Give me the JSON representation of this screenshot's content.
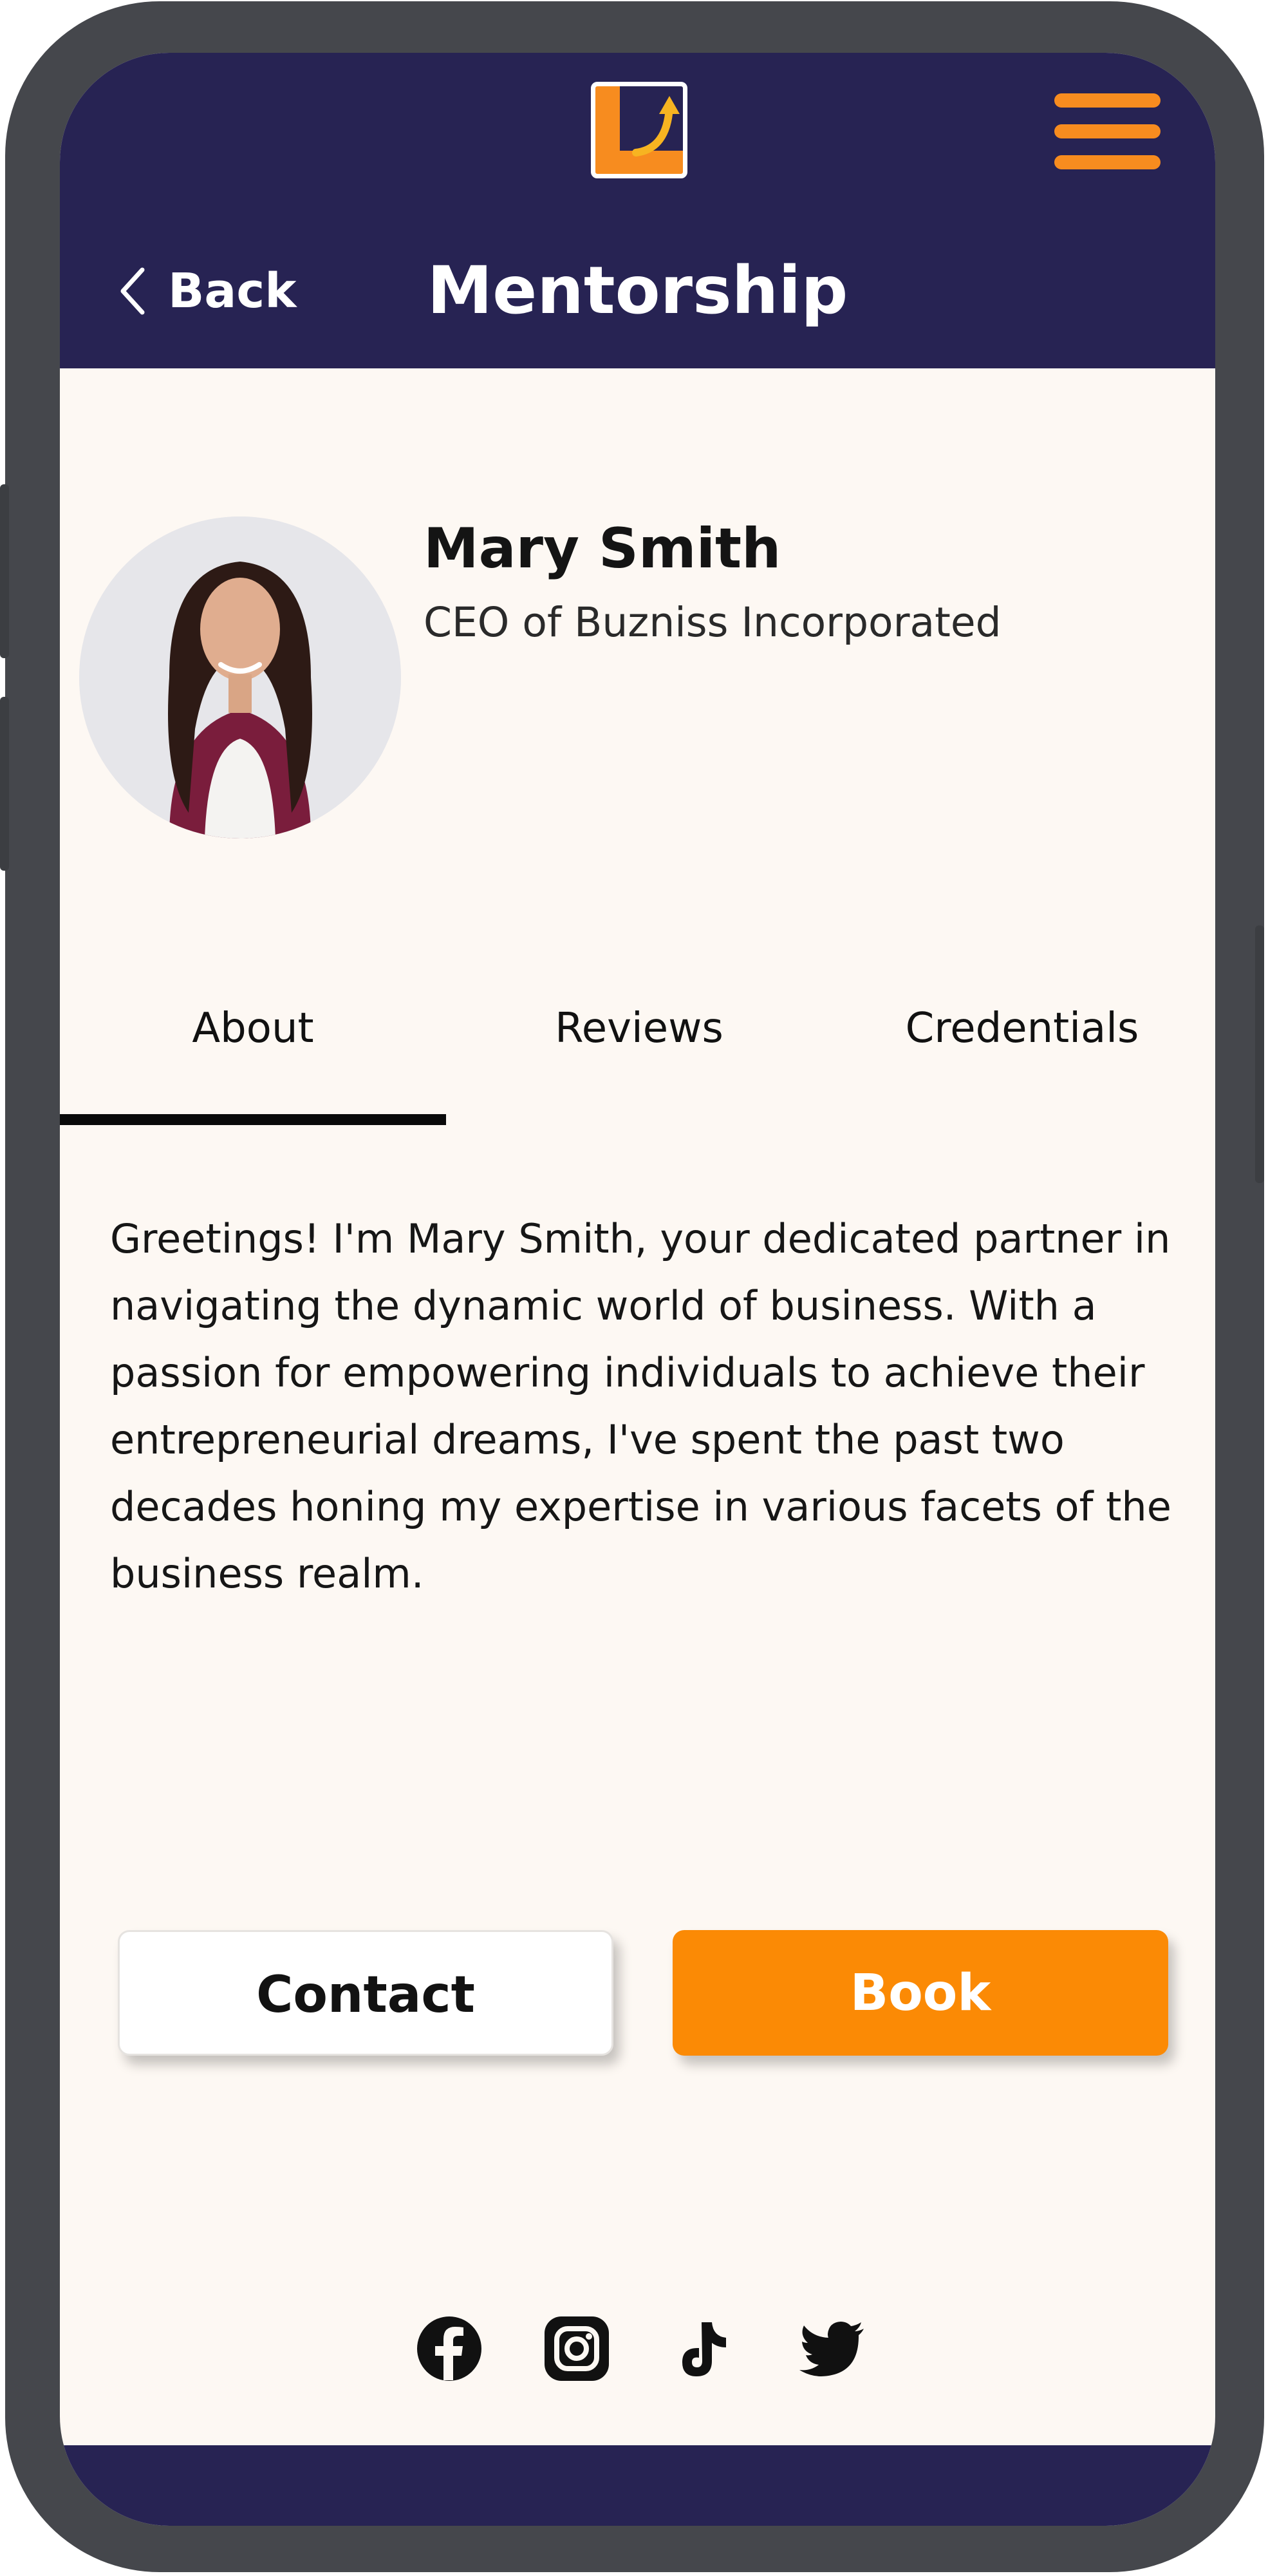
{
  "header": {
    "back_label": "Back",
    "title": "Mentorship"
  },
  "profile": {
    "name": "Mary Smith",
    "title": "CEO of Buzniss Incorporated"
  },
  "tabs": [
    {
      "label": "About",
      "active": true
    },
    {
      "label": "Reviews",
      "active": false
    },
    {
      "label": "Credentials",
      "active": false
    }
  ],
  "about": {
    "text": "Greetings! I'm Mary Smith, your dedicated partner in navigating the dynamic world of business. With a passion for empowering individuals to achieve their entrepreneurial dreams, I've spent the past two decades honing my expertise in various facets of the business realm."
  },
  "actions": {
    "contact_label": "Contact",
    "book_label": "Book"
  },
  "social": [
    "facebook-icon",
    "instagram-icon",
    "tiktok-icon",
    "twitter-icon"
  ],
  "colors": {
    "header_bg": "#272353",
    "accent": "#fb8a05",
    "screen_bg": "#fdf8f3"
  }
}
